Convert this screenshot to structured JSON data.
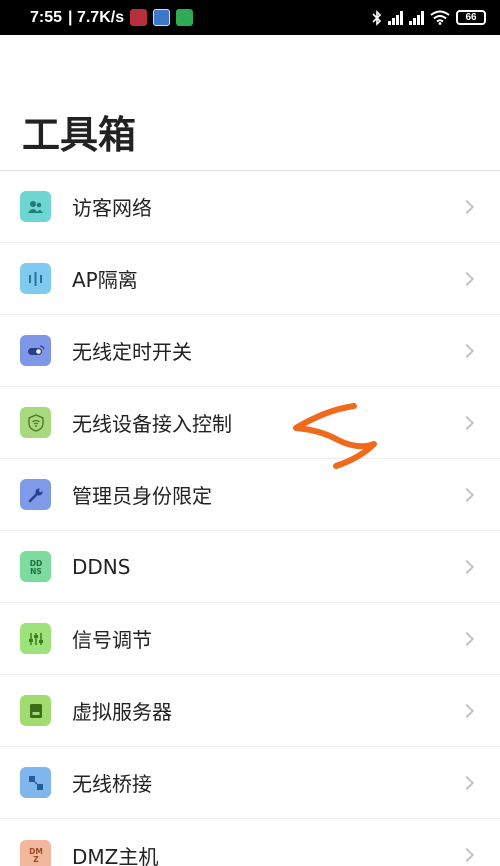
{
  "status_bar": {
    "time": "7:55",
    "net_speed": "| 7.7K/s",
    "battery": "66",
    "icons": [
      "notification-app-icon",
      "translate-app-icon",
      "phone-app-icon",
      "bluetooth-icon",
      "signal-hd-icon",
      "signal-hd-icon",
      "wifi-icon",
      "battery-icon"
    ]
  },
  "page": {
    "title": "工具箱"
  },
  "menu": {
    "items": [
      {
        "label": "访客网络",
        "icon": "guest-network-icon",
        "color": "#6ed6d0"
      },
      {
        "label": "AP隔离",
        "icon": "ap-isolation-icon",
        "color": "#7ecbef"
      },
      {
        "label": "无线定时开关",
        "icon": "wireless-timer-toggle-icon",
        "color": "#7f97e6"
      },
      {
        "label": "无线设备接入控制",
        "icon": "wifi-access-control-icon",
        "color": "#a9d97f"
      },
      {
        "label": "管理员身份限定",
        "icon": "admin-wrench-icon",
        "color": "#7f9be8"
      },
      {
        "label": "DDNS",
        "icon": "ddns-icon",
        "color": "#7edba0"
      },
      {
        "label": "信号调节",
        "icon": "signal-adjust-icon",
        "color": "#9de27a"
      },
      {
        "label": "虚拟服务器",
        "icon": "virtual-server-icon",
        "color": "#a3dc6e"
      },
      {
        "label": "无线桥接",
        "icon": "wireless-bridge-icon",
        "color": "#7fb6ec"
      },
      {
        "label": "DMZ主机",
        "icon": "dmz-host-icon",
        "color": "#f2b79d"
      }
    ]
  },
  "annotation": {
    "type": "hand-drawn-arrow",
    "color": "#f06a1e"
  }
}
